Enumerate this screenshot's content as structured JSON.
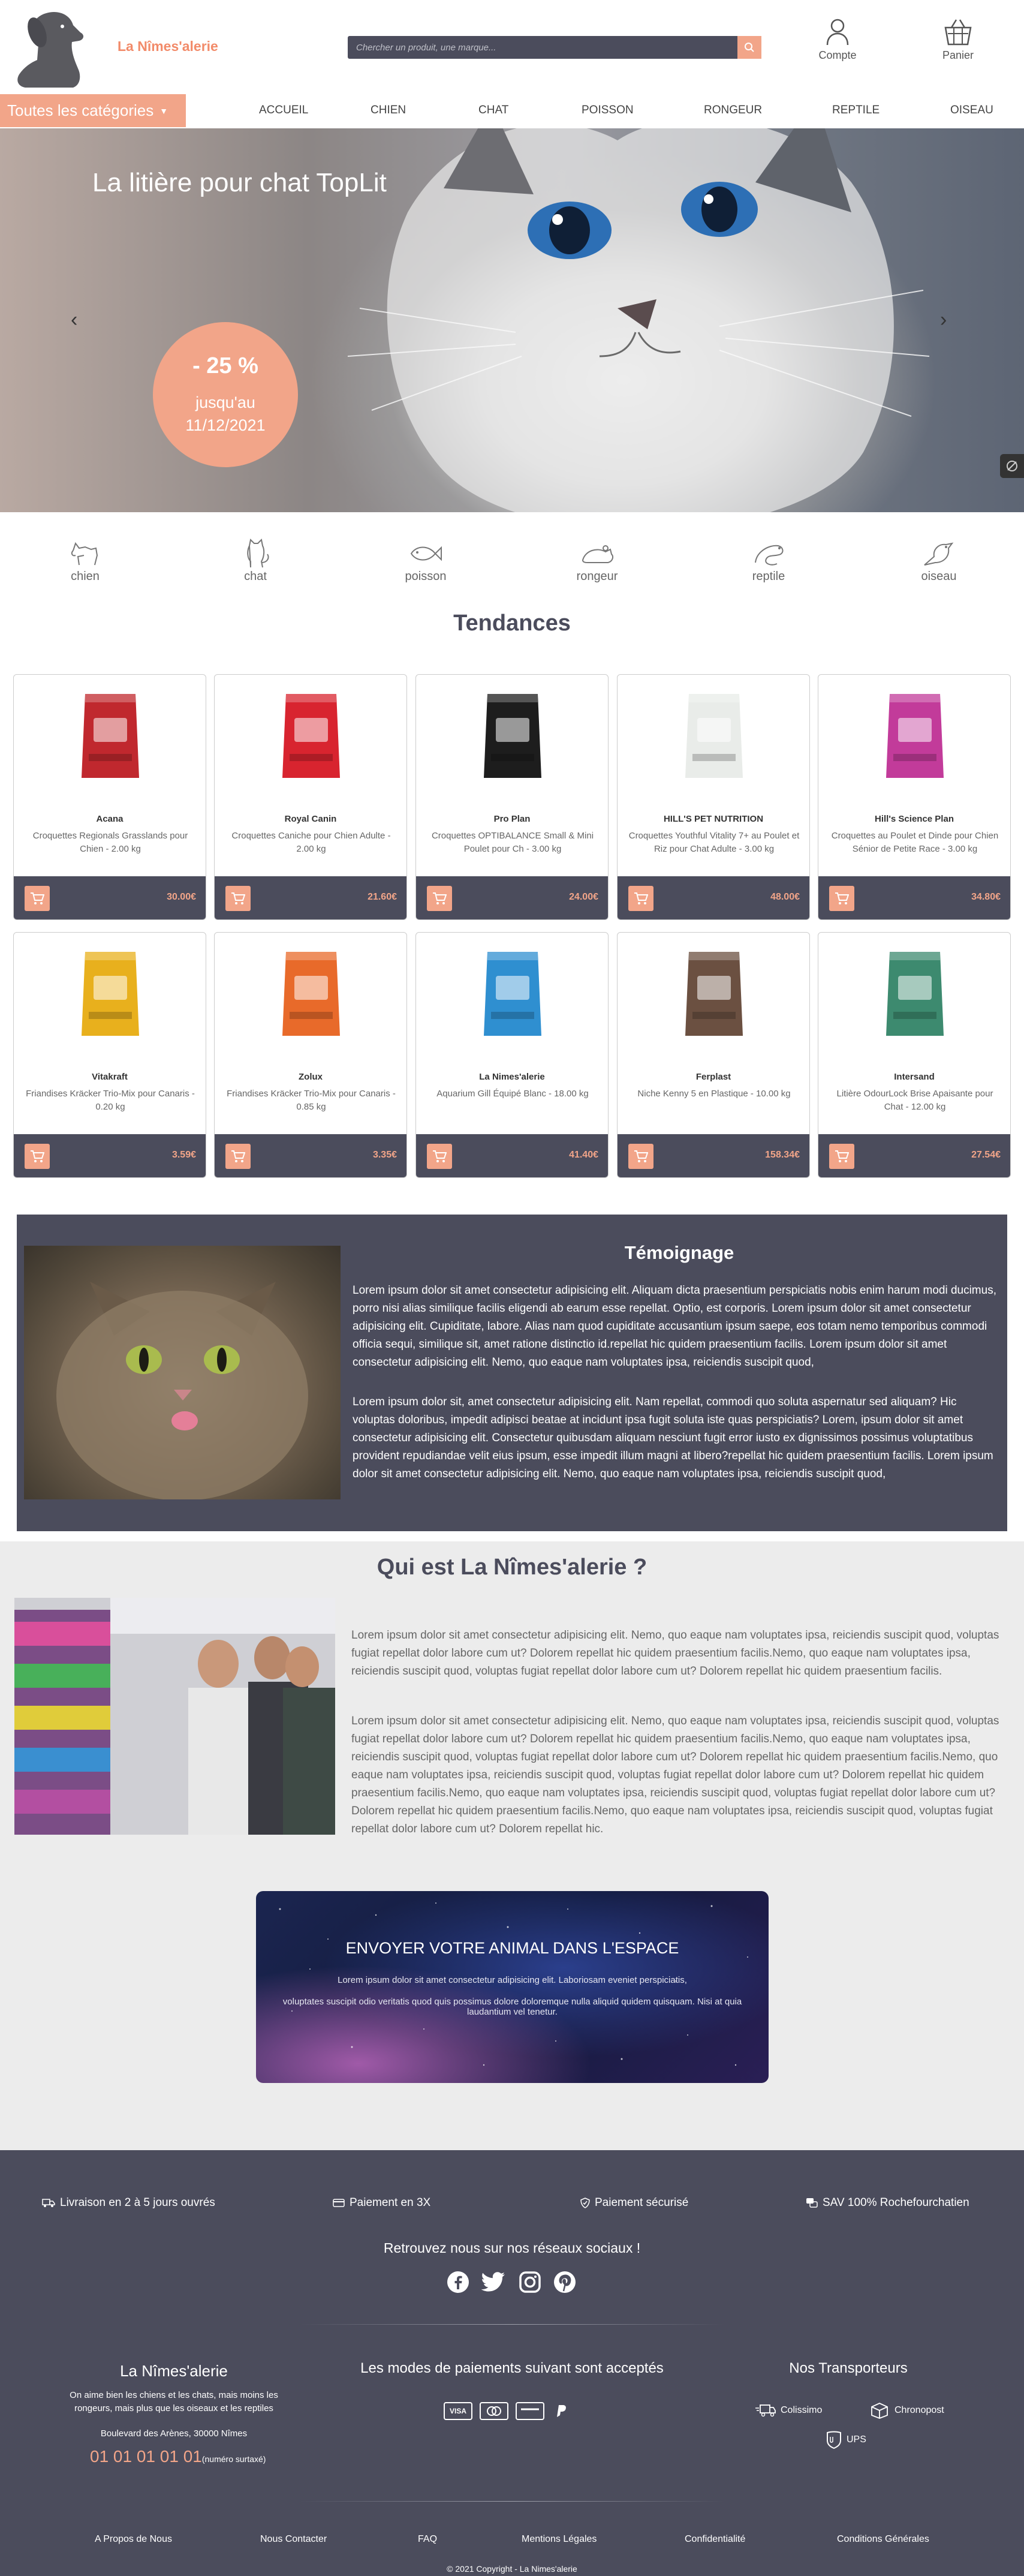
{
  "header": {
    "brand": "La Nîmes'alerie",
    "search_placeholder": "Chercher un produit, une marque...",
    "account_label": "Compte",
    "cart_label": "Panier"
  },
  "nav": {
    "categories_button": "Toutes les catégories",
    "items": [
      "ACCUEIL",
      "CHIEN",
      "CHAT",
      "POISSON",
      "RONGEUR",
      "REPTILE",
      "OISEAU"
    ]
  },
  "hero": {
    "title": "La litière pour chat TopLit",
    "discount": "- 25 %",
    "until_line1": "jusqu'au",
    "until_line2": "11/12/2021",
    "prev_arrow": "‹",
    "next_arrow": "›"
  },
  "animals": [
    "chien",
    "chat",
    "poisson",
    "rongeur",
    "reptile",
    "oiseau"
  ],
  "tendances": {
    "title": "Tendances",
    "products": [
      {
        "brand": "Acana",
        "desc": "Croquettes Regionals Grasslands pour Chien - 2.00 kg",
        "price": "30.00€",
        "color": "#c0282e"
      },
      {
        "brand": "Royal Canin",
        "desc": "Croquettes Caniche pour Chien Adulte - 2.00 kg",
        "price": "21.60€",
        "color": "#d8242f"
      },
      {
        "brand": "Pro Plan",
        "desc": "Croquettes OPTIBALANCE Small & Mini Poulet pour Ch - 3.00 kg",
        "price": "24.00€",
        "color": "#1d1d1d"
      },
      {
        "brand": "HILL'S PET NUTRITION",
        "desc": "Croquettes Youthful Vitality 7+ au Poulet et Riz pour Chat Adulte - 3.00 kg",
        "price": "48.00€",
        "color": "#e9ece9"
      },
      {
        "brand": "Hill's Science Plan",
        "desc": "Croquettes au Poulet et Dinde pour Chien Sénior de Petite Race - 3.00 kg",
        "price": "34.80€",
        "color": "#c23b9a"
      },
      {
        "brand": "Vitakraft",
        "desc": "Friandises Kräcker Trio-Mix pour Canaris - 0.20 kg",
        "price": "3.59€",
        "color": "#e8b01d"
      },
      {
        "brand": "Zolux",
        "desc": "Friandises Kräcker Trio-Mix pour Canaris - 0.85 kg",
        "price": "3.35€",
        "color": "#e86a2a"
      },
      {
        "brand": "La Nimes'alerie",
        "desc": "Aquarium Gill Équipé Blanc - 18.00 kg",
        "price": "41.40€",
        "color": "#2f8fd0"
      },
      {
        "brand": "Ferplast",
        "desc": "Niche Kenny 5 en Plastique - 10.00 kg",
        "price": "158.34€",
        "color": "#6b5041"
      },
      {
        "brand": "Intersand",
        "desc": "Litière OdourLock Brise Apaisante pour Chat - 12.00 kg",
        "price": "27.54€",
        "color": "#3d8a6f"
      }
    ]
  },
  "testimonial": {
    "title": "Témoignage",
    "p1": "Lorem ipsum dolor sit amet consectetur adipisicing elit. Aliquam dicta praesentium perspiciatis nobis enim harum modi ducimus, porro nisi alias similique facilis eligendi ab earum esse repellat. Optio, est corporis. Lorem ipsum dolor sit amet consectetur adipisicing elit. Cupiditate, labore. Alias nam quod cupiditate accusantium ipsum saepe, eos totam nemo temporibus commodi officia sequi, similique sit, amet ratione distinctio id.repellat hic quidem praesentium facilis. Lorem ipsum dolor sit amet consectetur adipisicing elit. Nemo, quo eaque nam voluptates ipsa, reiciendis suscipit quod,",
    "p2": "Lorem ipsum dolor sit, amet consectetur adipisicing elit. Nam repellat, commodi quo soluta aspernatur sed aliquam? Hic voluptas doloribus, impedit adipisci beatae at incidunt ipsa fugit soluta iste quas perspiciatis? Lorem, ipsum dolor sit amet consectetur adipisicing elit. Consectetur quibusdam aliquam nesciunt fugit error iusto ex dignissimos possimus voluptatibus provident repudiandae velit eius ipsum, esse impedit illum magni at libero?repellat hic quidem praesentium facilis. Lorem ipsum dolor sit amet consectetur adipisicing elit. Nemo, quo eaque nam voluptates ipsa, reiciendis suscipit quod,"
  },
  "about": {
    "title": "Qui est La Nîmes'alerie ?",
    "p1": "Lorem ipsum dolor sit amet consectetur adipisicing elit. Nemo, quo eaque nam voluptates ipsa, reiciendis suscipit quod, voluptas fugiat repellat dolor labore cum ut? Dolorem repellat hic quidem praesentium facilis.Nemo, quo eaque nam voluptates ipsa, reiciendis suscipit quod, voluptas fugiat repellat dolor labore cum ut? Dolorem repellat hic quidem praesentium facilis.",
    "p2": "Lorem ipsum dolor sit amet consectetur adipisicing elit. Nemo, quo eaque nam voluptates ipsa, reiciendis suscipit quod, voluptas fugiat repellat dolor labore cum ut? Dolorem repellat hic quidem praesentium facilis.Nemo, quo eaque nam voluptates ipsa, reiciendis suscipit quod, voluptas fugiat repellat dolor labore cum ut? Dolorem repellat hic quidem praesentium facilis.Nemo, quo eaque nam voluptates ipsa, reiciendis suscipit quod, voluptas fugiat repellat dolor labore cum ut? Dolorem repellat hic quidem praesentium facilis.Nemo, quo eaque nam voluptates ipsa, reiciendis suscipit quod, voluptas fugiat repellat dolor labore cum ut? Dolorem repellat hic quidem praesentium facilis.Nemo, quo eaque nam voluptates ipsa, reiciendis suscipit quod, voluptas fugiat repellat dolor labore cum ut? Dolorem repellat hic."
  },
  "space": {
    "title": "ENVOYER VOTRE ANIMAL DANS L'ESPACE",
    "line1": "Lorem ipsum dolor sit amet consectetur adipisicing elit. Laboriosam eveniet perspiciatis,",
    "line2": "voluptates suscipit odio veritatis quod quis possimus dolore doloremque nulla aliquid quidem quisquam. Nisi at quia laudantium vel tenetur."
  },
  "footer": {
    "features": [
      "Livraison en 2 à 5 jours ouvrés",
      "Paiement en 3X",
      "Paiement sécurisé",
      "SAV 100% Rochefourchatien"
    ],
    "social_title": "Retrouvez nous sur nos réseaux sociaux !",
    "company_title": "La Nîmes'alerie",
    "company_line1": "On aime bien les chiens et les chats, mais moins les",
    "company_line2": "rongeurs, mais plus que les oiseaux et les reptiles",
    "address": "Boulevard des Arènes, 30000 Nîmes",
    "phone": "01 01 01 01 01",
    "phone_note": "(numéro surtaxé)",
    "payments_title": "Les modes de paiements suivant sont acceptés",
    "payment_visa": "VISA",
    "carriers_title": "Nos Transporteurs",
    "carriers": [
      "Colissimo",
      "Chronopost",
      "UPS"
    ],
    "links": [
      "A Propos de Nous",
      "Nous Contacter",
      "FAQ",
      "Mentions Légales",
      "Confidentialité",
      "Conditions Générales"
    ],
    "copyright": "© 2021 Copyright - La Nimes'alerie"
  },
  "colors": {
    "accent": "#f2a589",
    "dark": "#4b4c5c"
  }
}
